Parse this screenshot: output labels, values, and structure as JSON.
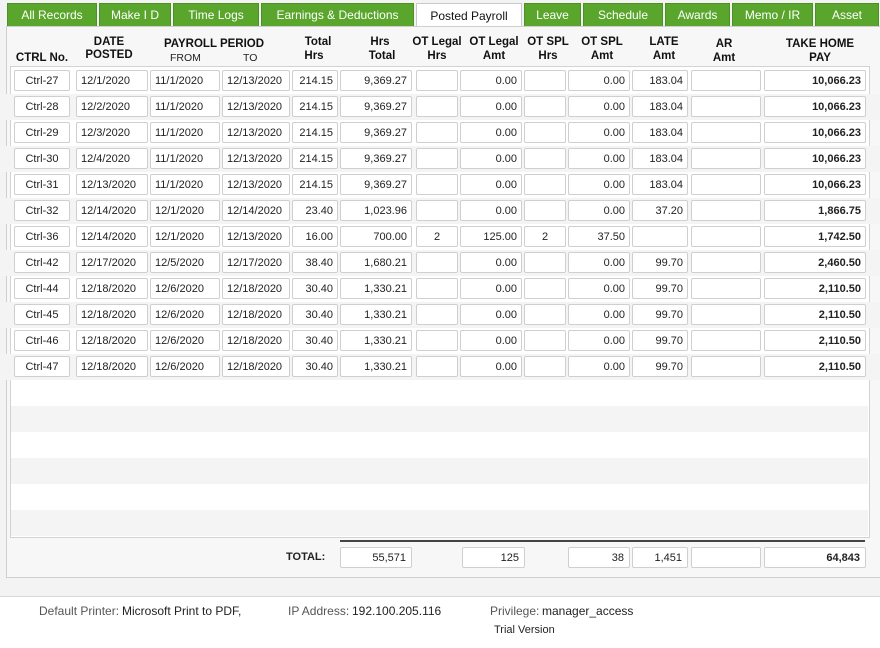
{
  "tabs": [
    {
      "label": "All Records",
      "active": false
    },
    {
      "label": "Make I D",
      "active": false
    },
    {
      "label": "Time Logs",
      "active": false
    },
    {
      "label": "Earnings & Deductions",
      "active": false
    },
    {
      "label": "Posted Payroll",
      "active": true
    },
    {
      "label": "Leave",
      "active": false
    },
    {
      "label": "Schedule",
      "active": false
    },
    {
      "label": "Awards",
      "active": false
    },
    {
      "label": "Memo / IR",
      "active": false
    },
    {
      "label": "Asset",
      "active": false
    }
  ],
  "headers": {
    "ctrl": "CTRL No.",
    "date1": "DATE",
    "date2": "POSTED",
    "period": "PAYROLL PERIOD",
    "from": "FROM",
    "to": "TO",
    "total1": "Total",
    "total2": "Hrs",
    "hrs1": "Hrs",
    "hrs2": "Total",
    "otl1": "OT Legal",
    "otl2": "Hrs",
    "otla1": "OT Legal",
    "otla2": "Amt",
    "ots1": "OT SPL",
    "ots2": "Hrs",
    "otsa1": "OT SPL",
    "otsa2": "Amt",
    "late1": "LATE",
    "late2": "Amt",
    "ar1": "AR",
    "ar2": "Amt",
    "take1": "TAKE HOME",
    "take2": "PAY"
  },
  "rows": [
    {
      "ctrl": "Ctrl-27",
      "posted": "12/1/2020",
      "from": "11/1/2020",
      "to": "12/13/2020",
      "total_hrs": "214.15",
      "hrs_total": "9,369.27",
      "ot_legal_hrs": "",
      "ot_legal_amt": "0.00",
      "ot_spl_hrs": "",
      "ot_spl_amt": "0.00",
      "late_amt": "183.04",
      "ar_amt": "",
      "take_home": "10,066.23"
    },
    {
      "ctrl": "Ctrl-28",
      "posted": "12/2/2020",
      "from": "11/1/2020",
      "to": "12/13/2020",
      "total_hrs": "214.15",
      "hrs_total": "9,369.27",
      "ot_legal_hrs": "",
      "ot_legal_amt": "0.00",
      "ot_spl_hrs": "",
      "ot_spl_amt": "0.00",
      "late_amt": "183.04",
      "ar_amt": "",
      "take_home": "10,066.23"
    },
    {
      "ctrl": "Ctrl-29",
      "posted": "12/3/2020",
      "from": "11/1/2020",
      "to": "12/13/2020",
      "total_hrs": "214.15",
      "hrs_total": "9,369.27",
      "ot_legal_hrs": "",
      "ot_legal_amt": "0.00",
      "ot_spl_hrs": "",
      "ot_spl_amt": "0.00",
      "late_amt": "183.04",
      "ar_amt": "",
      "take_home": "10,066.23"
    },
    {
      "ctrl": "Ctrl-30",
      "posted": "12/4/2020",
      "from": "11/1/2020",
      "to": "12/13/2020",
      "total_hrs": "214.15",
      "hrs_total": "9,369.27",
      "ot_legal_hrs": "",
      "ot_legal_amt": "0.00",
      "ot_spl_hrs": "",
      "ot_spl_amt": "0.00",
      "late_amt": "183.04",
      "ar_amt": "",
      "take_home": "10,066.23"
    },
    {
      "ctrl": "Ctrl-31",
      "posted": "12/13/2020",
      "from": "11/1/2020",
      "to": "12/13/2020",
      "total_hrs": "214.15",
      "hrs_total": "9,369.27",
      "ot_legal_hrs": "",
      "ot_legal_amt": "0.00",
      "ot_spl_hrs": "",
      "ot_spl_amt": "0.00",
      "late_amt": "183.04",
      "ar_amt": "",
      "take_home": "10,066.23"
    },
    {
      "ctrl": "Ctrl-32",
      "posted": "12/14/2020",
      "from": "12/1/2020",
      "to": "12/14/2020",
      "total_hrs": "23.40",
      "hrs_total": "1,023.96",
      "ot_legal_hrs": "",
      "ot_legal_amt": "0.00",
      "ot_spl_hrs": "",
      "ot_spl_amt": "0.00",
      "late_amt": "37.20",
      "ar_amt": "",
      "take_home": "1,866.75"
    },
    {
      "ctrl": "Ctrl-36",
      "posted": "12/14/2020",
      "from": "12/1/2020",
      "to": "12/13/2020",
      "total_hrs": "16.00",
      "hrs_total": "700.00",
      "ot_legal_hrs": "2",
      "ot_legal_amt": "125.00",
      "ot_spl_hrs": "2",
      "ot_spl_amt": "37.50",
      "late_amt": "",
      "ar_amt": "",
      "take_home": "1,742.50"
    },
    {
      "ctrl": "Ctrl-42",
      "posted": "12/17/2020",
      "from": "12/5/2020",
      "to": "12/17/2020",
      "total_hrs": "38.40",
      "hrs_total": "1,680.21",
      "ot_legal_hrs": "",
      "ot_legal_amt": "0.00",
      "ot_spl_hrs": "",
      "ot_spl_amt": "0.00",
      "late_amt": "99.70",
      "ar_amt": "",
      "take_home": "2,460.50"
    },
    {
      "ctrl": "Ctrl-44",
      "posted": "12/18/2020",
      "from": "12/6/2020",
      "to": "12/18/2020",
      "total_hrs": "30.40",
      "hrs_total": "1,330.21",
      "ot_legal_hrs": "",
      "ot_legal_amt": "0.00",
      "ot_spl_hrs": "",
      "ot_spl_amt": "0.00",
      "late_amt": "99.70",
      "ar_amt": "",
      "take_home": "2,110.50"
    },
    {
      "ctrl": "Ctrl-45",
      "posted": "12/18/2020",
      "from": "12/6/2020",
      "to": "12/18/2020",
      "total_hrs": "30.40",
      "hrs_total": "1,330.21",
      "ot_legal_hrs": "",
      "ot_legal_amt": "0.00",
      "ot_spl_hrs": "",
      "ot_spl_amt": "0.00",
      "late_amt": "99.70",
      "ar_amt": "",
      "take_home": "2,110.50"
    },
    {
      "ctrl": "Ctrl-46",
      "posted": "12/18/2020",
      "from": "12/6/2020",
      "to": "12/18/2020",
      "total_hrs": "30.40",
      "hrs_total": "1,330.21",
      "ot_legal_hrs": "",
      "ot_legal_amt": "0.00",
      "ot_spl_hrs": "",
      "ot_spl_amt": "0.00",
      "late_amt": "99.70",
      "ar_amt": "",
      "take_home": "2,110.50"
    },
    {
      "ctrl": "Ctrl-47",
      "posted": "12/18/2020",
      "from": "12/6/2020",
      "to": "12/18/2020",
      "total_hrs": "30.40",
      "hrs_total": "1,330.21",
      "ot_legal_hrs": "",
      "ot_legal_amt": "0.00",
      "ot_spl_hrs": "",
      "ot_spl_amt": "0.00",
      "late_amt": "99.70",
      "ar_amt": "",
      "take_home": "2,110.50"
    }
  ],
  "totals": {
    "label": "TOTAL:",
    "hrs_total": "55,571",
    "ot_legal_amt": "125",
    "ot_spl_amt": "38",
    "late_amt": "1,451",
    "ar_amt": "",
    "take_home": "64,843"
  },
  "status": {
    "printer_label": "Default Printer:",
    "printer_value": "Microsoft Print to PDF,",
    "ip_label": "IP Address:",
    "ip_value": "192.100.205.116",
    "privilege_label": "Privilege:",
    "privilege_value": "manager_access",
    "trial": "Trial Version"
  },
  "colors": {
    "tab_green": "#5aa62d",
    "tab_active": "#ffffff"
  }
}
